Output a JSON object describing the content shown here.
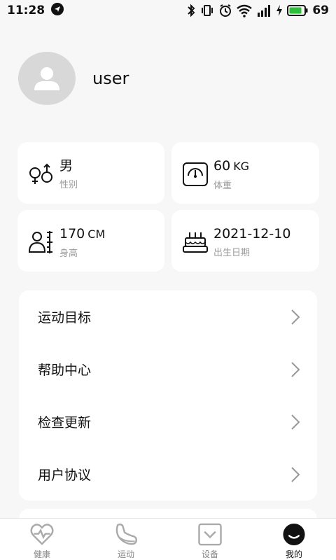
{
  "status_bar": {
    "time": "11:28",
    "battery_percent": "69",
    "battery_color": "#2dbf3a"
  },
  "profile": {
    "username": "user"
  },
  "info_cards": {
    "gender": {
      "value": "男",
      "label": "性别",
      "icon": "gender-icon"
    },
    "weight": {
      "value": "60",
      "unit": "KG",
      "label": "体重",
      "icon": "scale-icon"
    },
    "height": {
      "value": "170",
      "unit": "CM",
      "label": "身高",
      "icon": "height-icon"
    },
    "birthday": {
      "value": "2021-12-10",
      "label": "出生日期",
      "icon": "cake-icon"
    }
  },
  "menu": {
    "items": [
      {
        "label": "运动目标"
      },
      {
        "label": "帮助中心"
      },
      {
        "label": "检查更新"
      },
      {
        "label": "用户协议"
      }
    ]
  },
  "tabbar": {
    "tabs": [
      {
        "label": "健康"
      },
      {
        "label": "运动"
      },
      {
        "label": "设备"
      },
      {
        "label": "我的"
      }
    ],
    "active_index": 3
  }
}
